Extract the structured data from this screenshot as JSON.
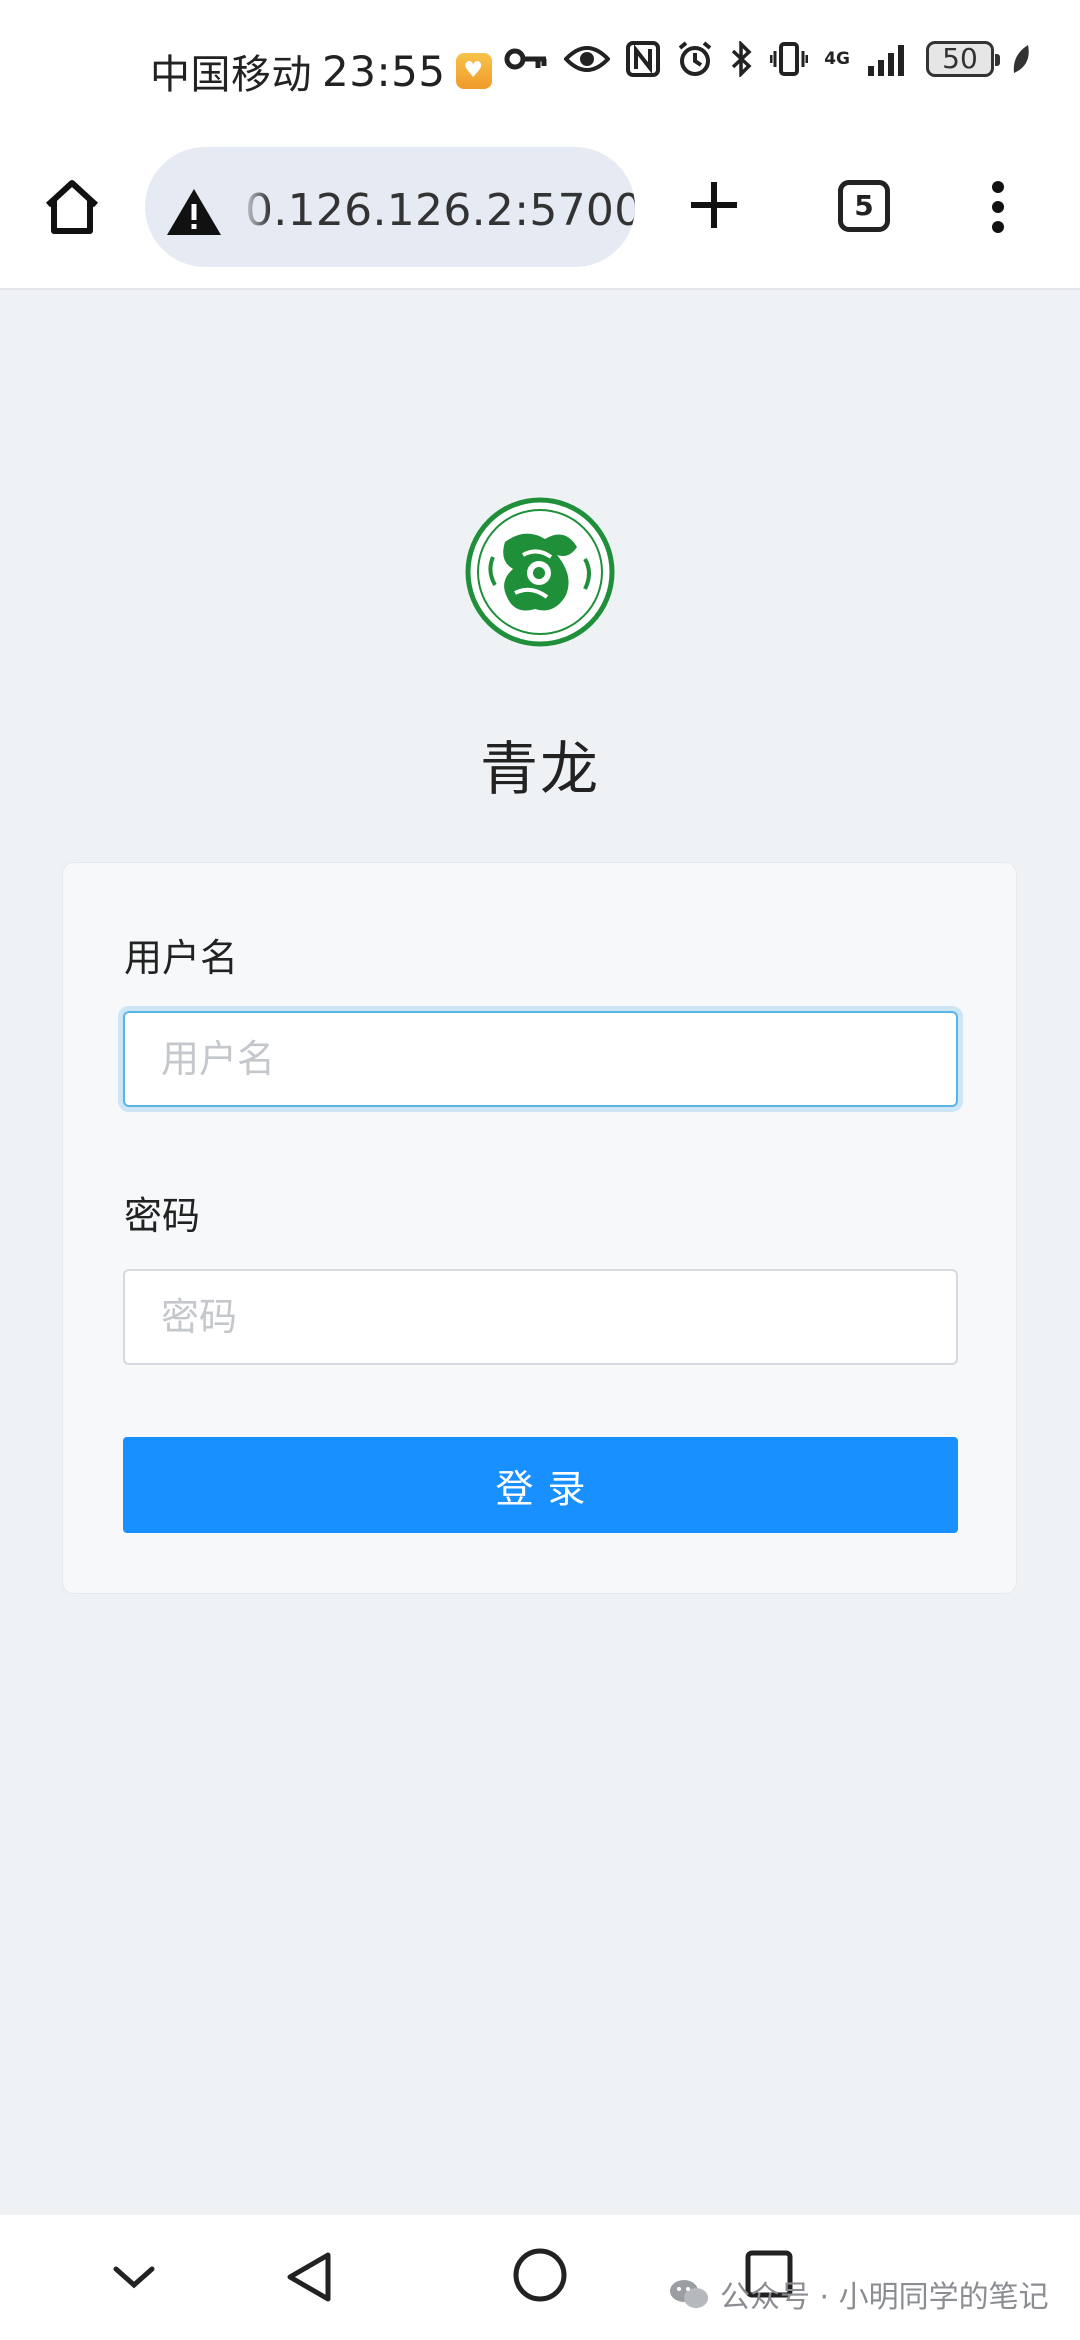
{
  "status_bar": {
    "carrier": "中国移动",
    "time": "23:55",
    "network": "4G",
    "battery": "50"
  },
  "browser": {
    "url": "0.126.126.2:5700",
    "tab_count": "5"
  },
  "page": {
    "app_title": "青龙",
    "username_label": "用户名",
    "username_placeholder": "用户名",
    "password_label": "密码",
    "password_placeholder": "密码",
    "login_button": "登录"
  },
  "watermark": {
    "text": "公众号 · 小明同学的笔记"
  },
  "colors": {
    "accent": "#1890ff",
    "background": "#eff2f5",
    "logo_green": "#1f8f3a"
  }
}
